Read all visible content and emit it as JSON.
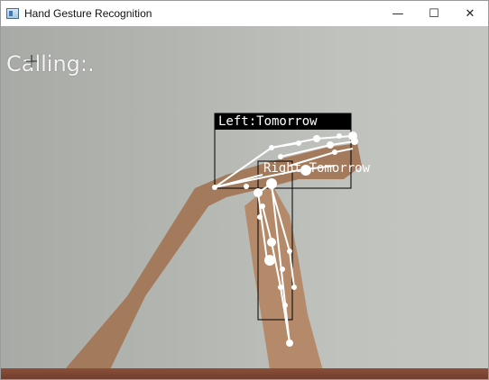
{
  "window": {
    "title": "Hand Gesture Recognition",
    "controls": {
      "minimize": "—",
      "maximize": "☐",
      "close": "✕"
    }
  },
  "overlay": {
    "status_text": "Calling:.",
    "left_label": "Left:Tomorrow",
    "right_label": "Right:Tomorrow"
  },
  "colors": {
    "skeleton": "#ffffff",
    "bbox": "#000000",
    "wall": "#b8bab6",
    "skin": "#b08363"
  }
}
